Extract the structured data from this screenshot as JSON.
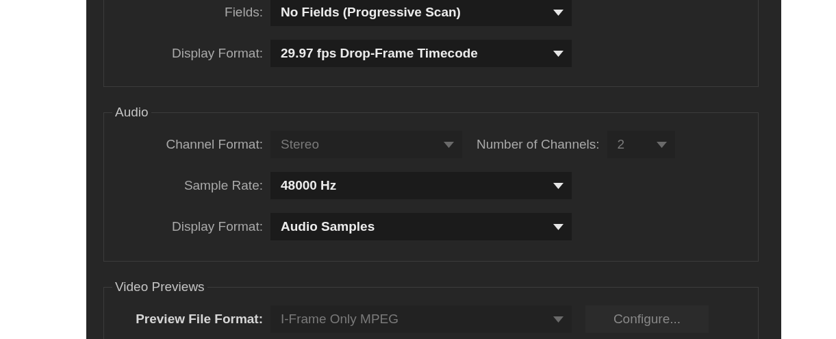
{
  "groups": [
    {
      "rows": [
        {
          "kind": "dropdown",
          "label": "Fields:",
          "value": "No Fields (Progressive Scan)",
          "disabled": false
        },
        {
          "kind": "dropdown",
          "label": "Display Format:",
          "value": "29.97 fps Drop-Frame Timecode",
          "disabled": false
        }
      ]
    },
    {
      "title": "Audio",
      "rows": [
        {
          "kind": "pair",
          "label": "Channel Format:",
          "value": "Stereo",
          "disabled": true,
          "label_2": "Number of Channels:",
          "value_2": "2",
          "disabled_2": true
        },
        {
          "kind": "dropdown",
          "label": "Sample Rate:",
          "value": "48000 Hz",
          "disabled": false
        },
        {
          "kind": "dropdown",
          "label": "Display Format:",
          "value": "Audio Samples",
          "disabled": false
        }
      ]
    },
    {
      "title": "Video Previews",
      "rows": [
        {
          "kind": "button",
          "label": "Preview File Format:",
          "value": "I-Frame Only MPEG",
          "disabled": true,
          "button": "Configure...",
          "emphasis": true
        }
      ]
    }
  ]
}
